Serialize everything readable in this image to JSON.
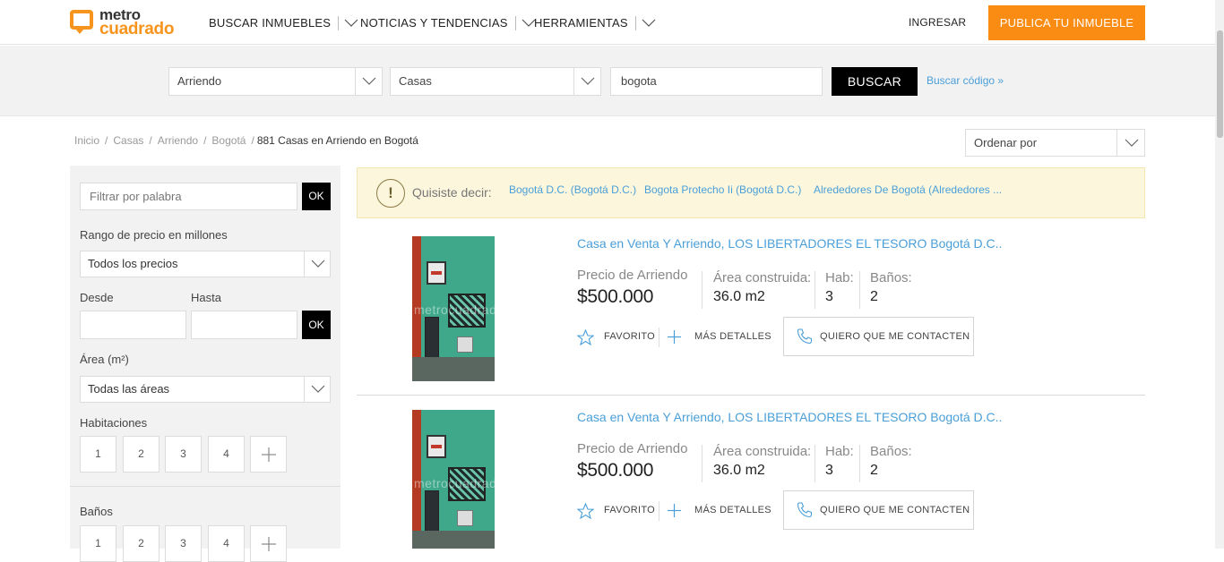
{
  "brand": {
    "line1": "metro",
    "line2": "cuadrado",
    "accent": "#f7941d"
  },
  "nav": [
    {
      "label": "BUSCAR INMUEBLES"
    },
    {
      "label": "NOTICIAS Y TENDENCIAS"
    },
    {
      "label": "HERRAMIENTAS"
    }
  ],
  "header": {
    "login": "INGRESAR",
    "publish": "PUBLICA TU INMUEBLE",
    "publish_color": "#fb8c13"
  },
  "search": {
    "operation": "Arriendo",
    "property_type": "Casas",
    "location": "bogota",
    "button": "BUSCAR",
    "code_link": "Buscar código »"
  },
  "breadcrumb": {
    "items": [
      "Inicio",
      "Casas",
      "Arriendo",
      "Bogotá"
    ],
    "current": "881 Casas en Arriendo en Bogotá"
  },
  "sort": {
    "label": "Ordenar por"
  },
  "sidebar": {
    "keyword_placeholder": "Filtrar por palabra",
    "ok": "OK",
    "price_range_label": "Rango de precio en millones",
    "price_select": "Todos los precios",
    "from_label": "Desde",
    "to_label": "Hasta",
    "area_label": "Área (m²)",
    "area_select": "Todas las áreas",
    "rooms_label": "Habitaciones",
    "rooms": [
      "1",
      "2",
      "3",
      "4"
    ],
    "baths_label": "Baños",
    "baths": [
      "1",
      "2",
      "3",
      "4"
    ]
  },
  "suggestion": {
    "prompt": "Quisiste decir:",
    "options": [
      "Bogotá D.C. (Bogotá D.C.)",
      "Bogota Protecho Ii (Bogotá D.C.)",
      "Alrededores De Bogotá (Alrededores ..."
    ]
  },
  "listings": [
    {
      "title": "Casa en Venta Y Arriendo, LOS LIBERTADORES EL TESORO Bogotá D.C..",
      "price_label": "Precio de Arriendo",
      "price": "$500.000",
      "area_label": "Área construida:",
      "area": "36.0 m2",
      "rooms_label": "Hab:",
      "rooms": "3",
      "baths_label": "Baños:",
      "baths": "2",
      "favorite": "FAVORITO",
      "details": "MÁS DETALLES",
      "contact": "QUIERO QUE ME CONTACTEN",
      "watermark": "metrocuadrado"
    },
    {
      "title": "Casa en Venta Y Arriendo, LOS LIBERTADORES EL TESORO Bogotá D.C..",
      "price_label": "Precio de Arriendo",
      "price": "$500.000",
      "area_label": "Área construida:",
      "area": "36.0 m2",
      "rooms_label": "Hab:",
      "rooms": "3",
      "baths_label": "Baños:",
      "baths": "2",
      "favorite": "FAVORITO",
      "details": "MÁS DETALLES",
      "contact": "QUIERO QUE ME CONTACTEN",
      "watermark": "metrocuadrado"
    }
  ],
  "colors": {
    "link": "#4a9fd8",
    "suggest_bg": "#fcf6dd"
  }
}
